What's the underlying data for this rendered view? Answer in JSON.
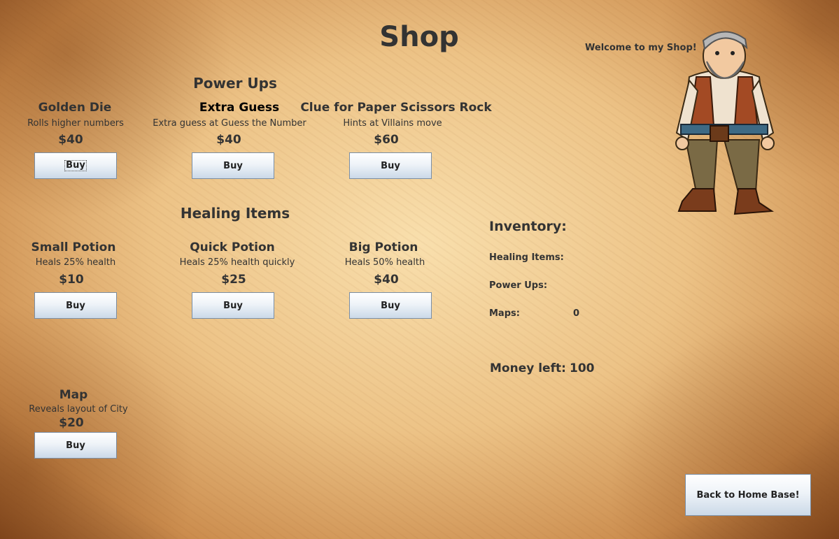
{
  "shop": {
    "title": "Shop",
    "welcome": "Welcome to my Shop!",
    "power_ups_heading": "Power Ups",
    "healing_heading": "Healing Items",
    "buy_label": "Buy",
    "power_ups": [
      {
        "name": "Golden Die",
        "desc": "Rolls higher numbers",
        "price": "$40"
      },
      {
        "name": "Extra Guess",
        "desc": "Extra guess at Guess the Number",
        "price": "$40"
      },
      {
        "name": "Clue for Paper Scissors Rock",
        "desc": "Hints at Villains move",
        "price": "$60"
      }
    ],
    "healing": [
      {
        "name": "Small Potion",
        "desc": "Heals 25% health",
        "price": "$10"
      },
      {
        "name": "Quick Potion",
        "desc": "Heals 25% health quickly",
        "price": "$25"
      },
      {
        "name": "Big Potion",
        "desc": "Heals 50% health",
        "price": "$40"
      }
    ],
    "map": {
      "name": "Map",
      "desc": "Reveals layout of City",
      "price": "$20"
    }
  },
  "inventory": {
    "heading": "Inventory:",
    "healing_label": "Healing Items:",
    "power_ups_label": "Power Ups:",
    "maps_label": "Maps:",
    "maps_value": "0",
    "money_label": "Money left:",
    "money_value": "100"
  },
  "back_button": "Back to Home Base!",
  "colors": {
    "parchment": "#e4bb82",
    "button_top": "#ffffff",
    "button_bottom": "#cbd9e8",
    "text": "#333333"
  }
}
